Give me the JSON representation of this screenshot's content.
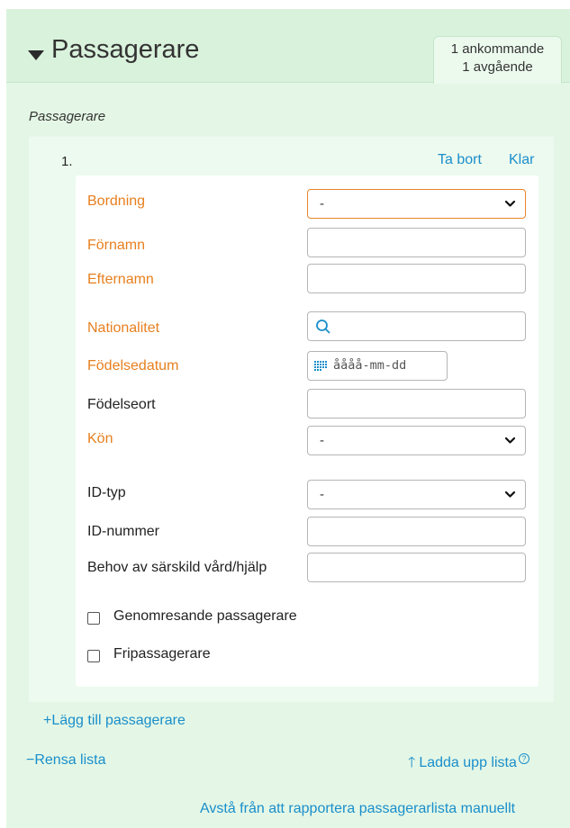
{
  "header": {
    "title": "Passagerare",
    "summary_arriving": "1 ankommande",
    "summary_departing": "1 avgående"
  },
  "section_label": "Passagerare",
  "passenger": {
    "number": "1.",
    "remove_label": "Ta bort",
    "done_label": "Klar"
  },
  "form": {
    "boarding_label": "Bordning",
    "boarding_value": "-",
    "first_name_label": "Förnamn",
    "last_name_label": "Efternamn",
    "nationality_label": "Nationalitet",
    "birthdate_label": "Födelsedatum",
    "birthdate_placeholder": "åååå-mm-dd",
    "birthplace_label": "Födelseort",
    "gender_label": "Kön",
    "gender_value": "-",
    "id_type_label": "ID-typ",
    "id_type_value": "-",
    "id_number_label": "ID-nummer",
    "special_care_label": "Behov av särskild vård/hjälp",
    "transit_label": "Genomresande passagerare",
    "free_label": "Fripassagerare"
  },
  "actions": {
    "add_passenger": "+Lägg till passagerare",
    "clear_list": "−Rensa lista",
    "upload_list": "Ladda upp lista",
    "opt_out": "Avstå från att rapportera passagerarlista manuellt"
  },
  "colors": {
    "required_label": "#e77f1e",
    "link": "#1a8ecb",
    "panel_bg": "#e4f7e6",
    "header_bg": "#d9f2dc"
  }
}
